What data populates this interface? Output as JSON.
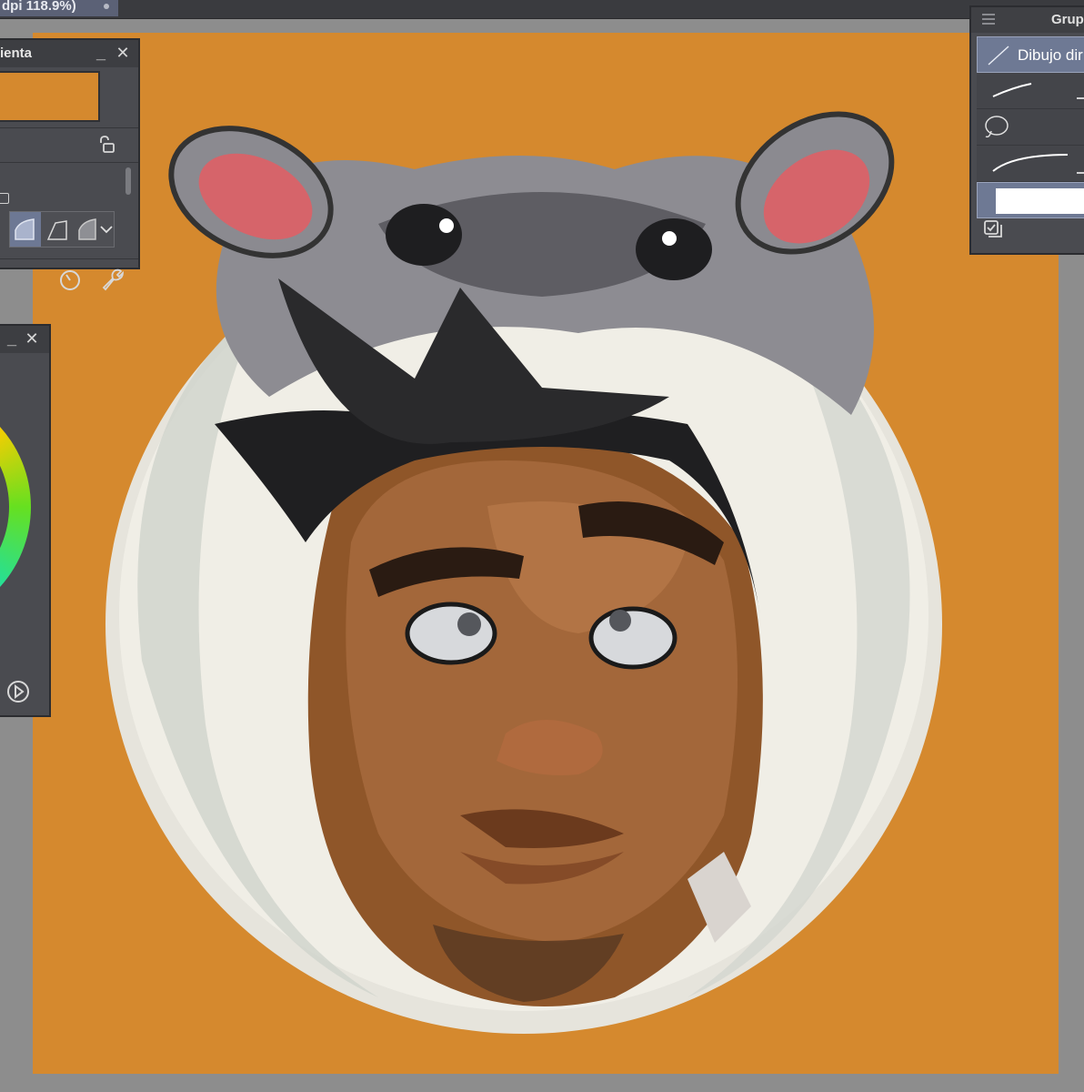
{
  "document": {
    "tab_title": "dpi 118.9%)"
  },
  "subtool_detail_panel": {
    "title": "ienta",
    "minimize": "_",
    "close": "✕",
    "main_color": "#d5892e"
  },
  "color_wheel_panel": {
    "minimize": "_",
    "close": "✕"
  },
  "subtool_group_panel": {
    "title": "Grup",
    "tools": [
      {
        "label": "Dibujo dir"
      }
    ]
  },
  "canvas": {
    "background": "#d5892e"
  },
  "colors": {
    "panel_bg": "#4a4b50",
    "panel_header": "#3d3e42",
    "selection": "#6e7994",
    "workspace": "#8d8d8d"
  }
}
